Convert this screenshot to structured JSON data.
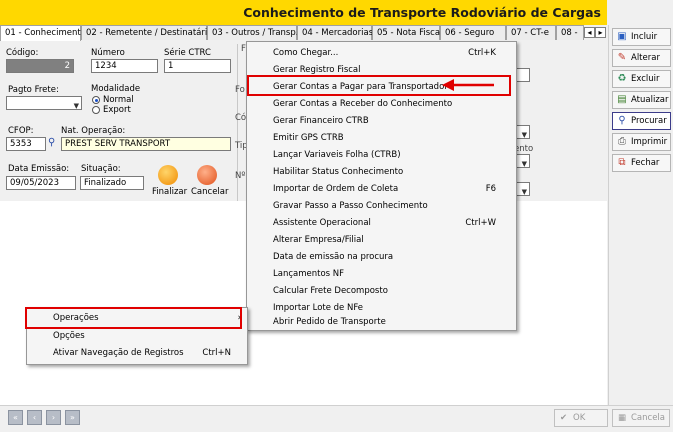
{
  "window": {
    "title": "Conhecimento de Transporte Rodoviário de Cargas"
  },
  "tabs": [
    {
      "label": "01 - Conhecimento"
    },
    {
      "label": "02 - Remetente / Destinatário"
    },
    {
      "label": "03 - Outros / Transp."
    },
    {
      "label": "04 - Mercadorias"
    },
    {
      "label": "05 - Nota Fiscal"
    },
    {
      "label": "06 - Seguro"
    },
    {
      "label": "07 - CT-e"
    },
    {
      "label": "08 -"
    }
  ],
  "tab_nav": {
    "prev": "◂",
    "next": "▸"
  },
  "form": {
    "codigo_label": "Código:",
    "codigo_value": "2",
    "numero_label": "Número",
    "numero_value": "1234",
    "serie_label": "Série CTRC",
    "serie_value": "1",
    "pagto_label": "Pagto Frete:",
    "pagto_value": "",
    "modalidade_label": "Modalidade",
    "modalidade_options": [
      "Normal",
      "Export"
    ],
    "cfop_label": "CFOP:",
    "cfop_value": "5353",
    "natop_label": "Nat. Operação:",
    "natop_value": "PREST SERV TRANSPORT",
    "data_label": "Data Emissão:",
    "data_value": "09/05/2023",
    "situacao_label": "Situação:",
    "situacao_value": "Finalizado",
    "finalizar_label": "Finalizar",
    "cancelar_label": "Cancelar",
    "partial_labels": [
      "F",
      "Fo",
      "Có",
      "Tip",
      "Nº",
      "ento"
    ]
  },
  "sidebar": [
    {
      "label": "Incluir",
      "icon": "new-doc-icon"
    },
    {
      "label": "Alterar",
      "icon": "edit-icon"
    },
    {
      "label": "Excluir",
      "icon": "delete-icon"
    },
    {
      "label": "Atualizar",
      "icon": "refresh-icon"
    },
    {
      "label": "Procurar",
      "icon": "binoculars-icon"
    },
    {
      "label": "Imprimir",
      "icon": "printer-icon"
    },
    {
      "label": "Fechar",
      "icon": "close-window-icon"
    }
  ],
  "context_menu": {
    "items": [
      {
        "label": "Operações",
        "has_submenu": true
      },
      {
        "label": "Opções",
        "has_submenu": false
      },
      {
        "label": "Ativar Navegação de Registros",
        "shortcut": "Ctrl+N"
      }
    ]
  },
  "submenu": {
    "items": [
      {
        "label": "Como Chegar...",
        "shortcut": "Ctrl+K"
      },
      {
        "label": "Gerar Registro Fiscal",
        "shortcut": ""
      },
      {
        "label": "Gerar Contas a Pagar para Transportador",
        "shortcut": ""
      },
      {
        "label": "Gerar Contas a Receber do Conhecimento",
        "shortcut": ""
      },
      {
        "label": "Gerar Financeiro CTRB",
        "shortcut": ""
      },
      {
        "label": "Emitir GPS CTRB",
        "shortcut": ""
      },
      {
        "label": "Lançar Variaveis Folha (CTRB)",
        "shortcut": ""
      },
      {
        "label": "Habilitar Status Conhecimento",
        "shortcut": ""
      },
      {
        "label": "Importar de Ordem de Coleta",
        "shortcut": "F6"
      },
      {
        "label": "Gravar Passo a Passo Conhecimento",
        "shortcut": ""
      },
      {
        "label": "Assistente Operacional",
        "shortcut": "Ctrl+W"
      },
      {
        "label": "Alterar Empresa/Filial",
        "shortcut": ""
      },
      {
        "label": "Data de emissão na procura",
        "shortcut": ""
      },
      {
        "label": "Lançamentos NF",
        "shortcut": ""
      },
      {
        "label": "Calcular Frete Decomposto",
        "shortcut": ""
      },
      {
        "label": "Importar Lote de NFe",
        "shortcut": ""
      },
      {
        "label": "Abrir Pedido de Transporte",
        "shortcut": ""
      }
    ]
  },
  "bottom": {
    "ok_label": "OK",
    "cancel_label": "Cancela"
  },
  "colors": {
    "title_bar": "#ffd800",
    "highlight": "#e00000",
    "annotation_arrow": "#e00000"
  }
}
